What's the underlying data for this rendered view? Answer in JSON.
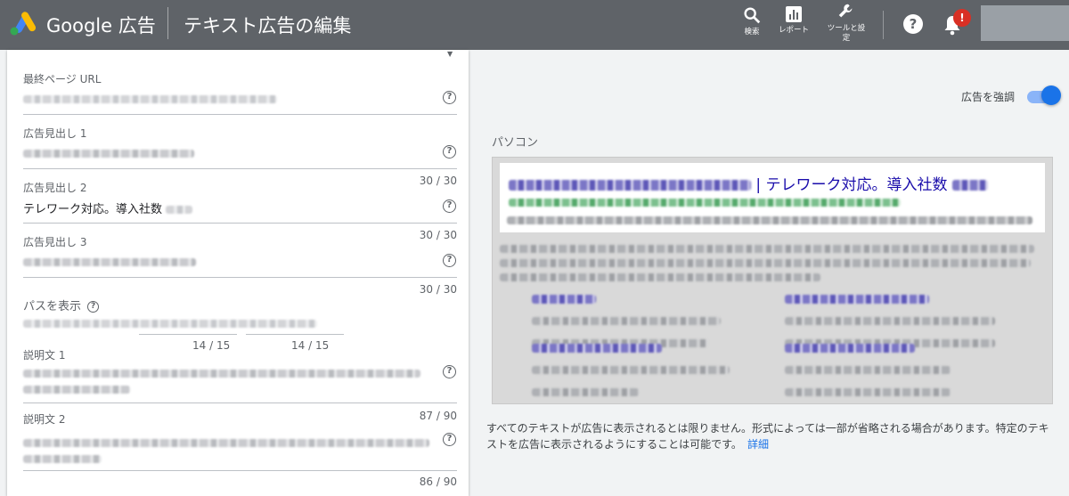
{
  "header": {
    "brand": "Google 広告",
    "page_title": "テキスト広告の編集",
    "tools": [
      {
        "label": "検索",
        "icon": "search-icon"
      },
      {
        "label": "レポート",
        "icon": "report-icon"
      },
      {
        "label_line1": "ツールと設",
        "label_line2": "定",
        "icon": "wrench-icon"
      }
    ],
    "help_symbol": "?",
    "notification_badge": "!"
  },
  "form": {
    "final_url": {
      "label": "最終ページ URL"
    },
    "headline1": {
      "label": "広告見出し 1",
      "count": "30 / 30"
    },
    "headline2": {
      "label": "広告見出し 2",
      "value": "テレワーク対応。導入社数",
      "count": "30 / 30"
    },
    "headline3": {
      "label": "広告見出し 3",
      "count": "30 / 30"
    },
    "path": {
      "label": "パスを表示",
      "count1": "14 / 15",
      "count2": "14 / 15"
    },
    "description1": {
      "label": "説明文 1",
      "count": "87 / 90"
    },
    "description2": {
      "label": "説明文 2",
      "count": "86 / 90"
    }
  },
  "preview": {
    "highlight_label": "広告を強調",
    "highlight_on": true,
    "device_label": "パソコン",
    "headline_visible": "| テレワーク対応。導入社数",
    "disclaimer": "すべてのテキストが広告に表示されるとは限りません。形式によっては一部が省略される場合があります。特定のテキストを広告に表示されるようにすることは可能です。",
    "details_link": "詳細"
  },
  "colors": {
    "topbar": "#5f6368",
    "accent": "#1a73e8",
    "ad_title": "#1a0dab",
    "badge": "#d93025"
  }
}
